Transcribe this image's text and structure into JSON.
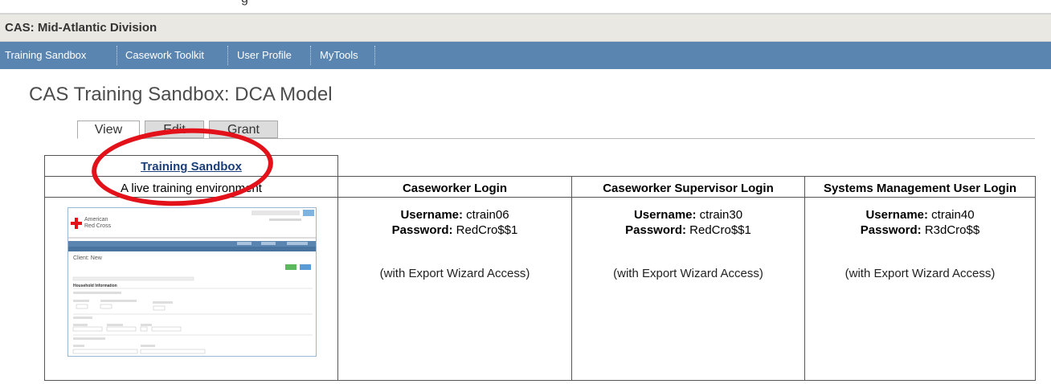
{
  "app": {
    "title": "CAS: Mid-Atlantic Division",
    "top_fragment": "g"
  },
  "nav": {
    "items": [
      {
        "label": "Training Sandbox"
      },
      {
        "label": "Casework Toolkit"
      },
      {
        "label": "User Profile"
      },
      {
        "label": "MyTools"
      }
    ]
  },
  "page": {
    "title": "CAS Training Sandbox: DCA Model"
  },
  "tabs": [
    {
      "label": "View",
      "active": true
    },
    {
      "label": "Edit",
      "active": false
    },
    {
      "label": "Grant",
      "active": false
    }
  ],
  "table": {
    "sandbox_link": "Training Sandbox",
    "sandbox_description": "A live training environment",
    "columns": [
      {
        "header": "Caseworker Login",
        "username_label": "Username:",
        "username": "ctrain06",
        "password_label": "Password:",
        "password": "RedCro$$1",
        "access": "(with Export Wizard Access)"
      },
      {
        "header": "Caseworker Supervisor Login",
        "username_label": "Username:",
        "username": "ctrain30",
        "password_label": "Password:",
        "password": "RedCro$$1",
        "access": "(with Export Wizard Access)"
      },
      {
        "header": "Systems Management User Login",
        "username_label": "Username:",
        "username": "ctrain40",
        "password_label": "Password:",
        "password": "R3dCro$$",
        "access": "(with Export Wizard Access)"
      }
    ]
  },
  "thumbnail": {
    "brand_line1": "American",
    "brand_line2": "Red Cross",
    "page_heading": "Client: New",
    "section_heading": "Household Information",
    "accent": "#5a85b0",
    "brand_color": "#e3111a"
  },
  "colors": {
    "navbar": "#5a85b0",
    "title_bar": "#e9e8e2",
    "highlight": "#e3111a",
    "link": "#1b3f7a"
  }
}
